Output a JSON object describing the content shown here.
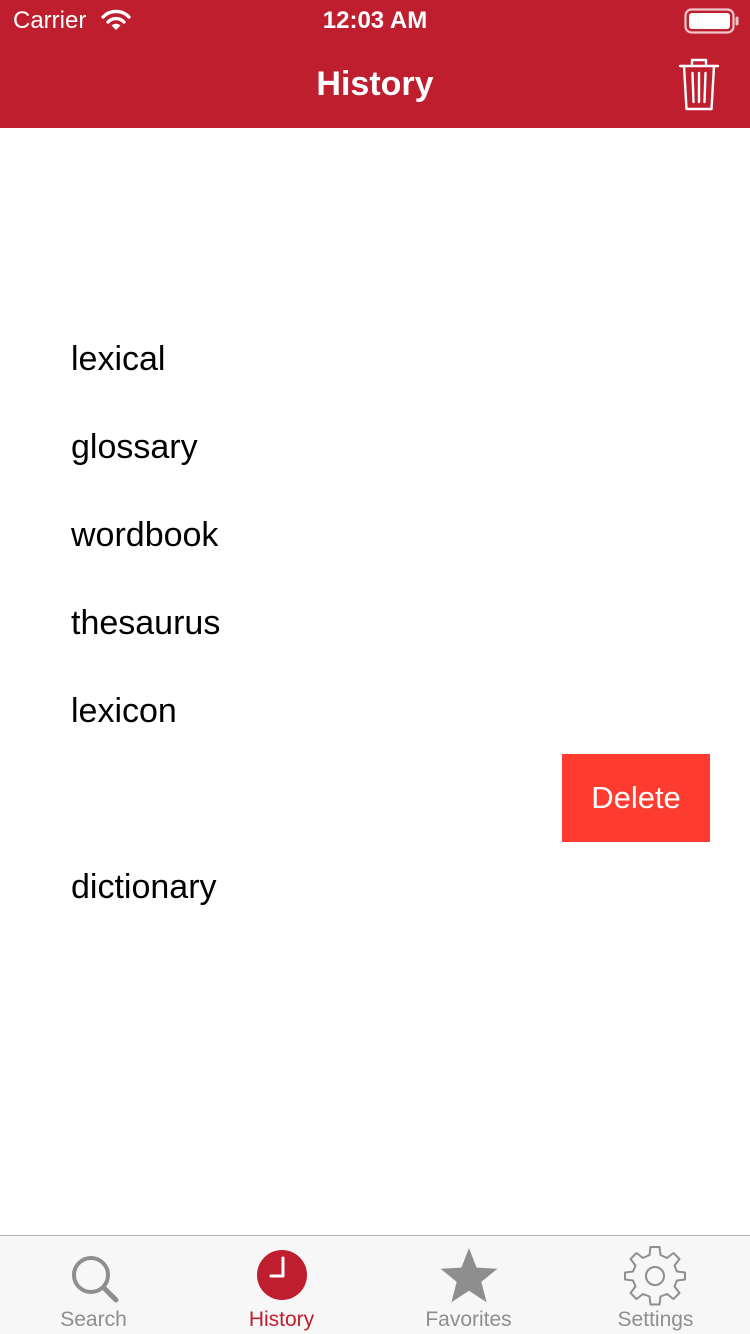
{
  "status_bar": {
    "carrier": "Carrier",
    "time": "12:03 AM"
  },
  "nav": {
    "title": "History",
    "trash_icon": "trash-icon"
  },
  "history": {
    "items": [
      {
        "word": "lexical"
      },
      {
        "word": "glossary"
      },
      {
        "word": "wordbook"
      },
      {
        "word": "thesaurus"
      },
      {
        "word": "lexicon"
      },
      {
        "word": ""
      },
      {
        "word": "dictionary"
      }
    ],
    "swiped_row_action": "Delete"
  },
  "tab_bar": {
    "active": "History",
    "tabs": [
      {
        "label": "Search",
        "icon": "search-icon"
      },
      {
        "label": "History",
        "icon": "clock-icon"
      },
      {
        "label": "Favorites",
        "icon": "star-icon"
      },
      {
        "label": "Settings",
        "icon": "gear-icon"
      }
    ]
  },
  "colors": {
    "brand": "#be1e2d",
    "delete": "#ff3b30",
    "tab_inactive": "#8e8e8e",
    "tab_bar_bg": "#f7f7f7"
  }
}
